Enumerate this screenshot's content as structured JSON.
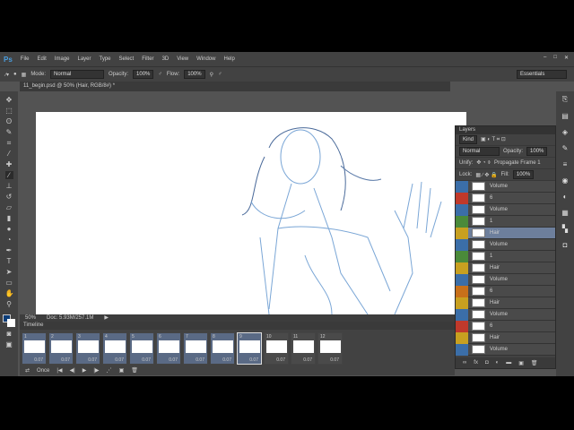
{
  "menu": {
    "logo": "Ps",
    "items": [
      "File",
      "Edit",
      "Image",
      "Layer",
      "Type",
      "Select",
      "Filter",
      "3D",
      "View",
      "Window",
      "Help"
    ]
  },
  "options": {
    "mode_label": "Mode:",
    "mode": "Normal",
    "opacity_label": "Opacity:",
    "opacity": "100%",
    "flow_label": "Flow:",
    "flow": "100%",
    "workspace": "Essentials"
  },
  "document": {
    "tab": "11_begin.psd @ 50% (Hair, RGB/8#) *",
    "zoom": "50%",
    "doc_size": "Doc: 5.93M/257.1M"
  },
  "timeline": {
    "title": "Timeline",
    "loop": "Once",
    "frames": [
      {
        "n": "1",
        "d": "0.07"
      },
      {
        "n": "2",
        "d": "0.07"
      },
      {
        "n": "3",
        "d": "0.07"
      },
      {
        "n": "4",
        "d": "0.07"
      },
      {
        "n": "5",
        "d": "0.07"
      },
      {
        "n": "6",
        "d": "0.07"
      },
      {
        "n": "7",
        "d": "0.07"
      },
      {
        "n": "8",
        "d": "0.07"
      },
      {
        "n": "9",
        "d": "0.07"
      },
      {
        "n": "10",
        "d": "0.07"
      },
      {
        "n": "11",
        "d": "0.07"
      },
      {
        "n": "12",
        "d": "0.07"
      }
    ]
  },
  "layers": {
    "title": "Layers",
    "kind": "Kind",
    "blend": "Normal",
    "opacity_label": "Opacity:",
    "opacity": "100%",
    "unify_label": "Unify:",
    "propagate": "Propagate Frame 1",
    "lock_label": "Lock:",
    "fill_label": "Fill:",
    "fill": "100%",
    "items": [
      {
        "name": "Volume",
        "color": "#3b6ea8"
      },
      {
        "name": "6",
        "color": "#c0392b"
      },
      {
        "name": "Volume",
        "color": "#3b6ea8"
      },
      {
        "name": "1",
        "color": "#4a8a3a"
      },
      {
        "name": "Hair",
        "color": "#c8a020",
        "selected": true
      },
      {
        "name": "Volume",
        "color": "#3b6ea8"
      },
      {
        "name": "1",
        "color": "#4a8a3a"
      },
      {
        "name": "Hair",
        "color": "#c8a020"
      },
      {
        "name": "Volume",
        "color": "#3b6ea8"
      },
      {
        "name": "6",
        "color": "#c8701a"
      },
      {
        "name": "Hair",
        "color": "#c8a020"
      },
      {
        "name": "Volume",
        "color": "#3b6ea8"
      },
      {
        "name": "6",
        "color": "#c0392b"
      },
      {
        "name": "Hair",
        "color": "#c8a020"
      },
      {
        "name": "Volume",
        "color": "#3b6ea8"
      }
    ]
  }
}
